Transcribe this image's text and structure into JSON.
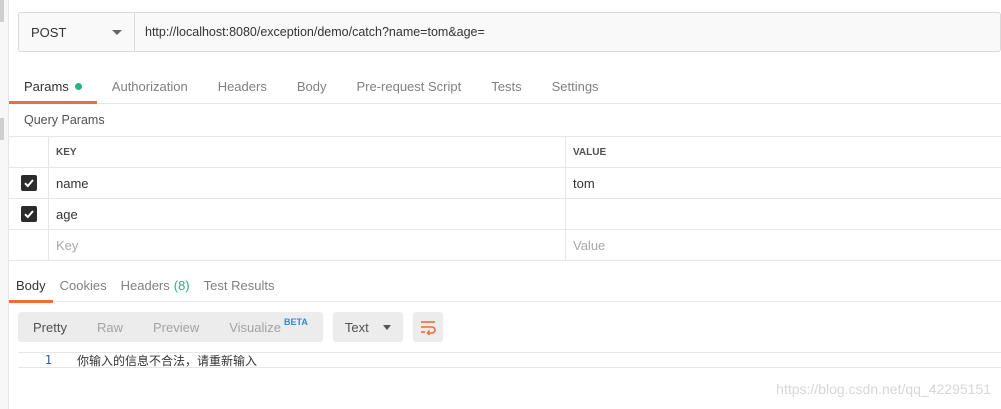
{
  "request": {
    "method": "POST",
    "url": "http://localhost:8080/exception/demo/catch?name=tom&age="
  },
  "request_tabs": [
    {
      "label": "Params",
      "active": true,
      "indicator": true
    },
    {
      "label": "Authorization"
    },
    {
      "label": "Headers"
    },
    {
      "label": "Body"
    },
    {
      "label": "Pre-request Script"
    },
    {
      "label": "Tests"
    },
    {
      "label": "Settings"
    }
  ],
  "query_params": {
    "title": "Query Params",
    "columns": {
      "key": "KEY",
      "value": "VALUE"
    },
    "rows": [
      {
        "checked": true,
        "key": "name",
        "value": "tom"
      },
      {
        "checked": true,
        "key": "age",
        "value": ""
      }
    ],
    "placeholder": {
      "key": "Key",
      "value": "Value"
    }
  },
  "response_tabs": {
    "body": "Body",
    "cookies": "Cookies",
    "headers": "Headers",
    "headers_count": "(8)",
    "test_results": "Test Results"
  },
  "response_toolbar": {
    "views": [
      "Pretty",
      "Raw",
      "Preview",
      "Visualize"
    ],
    "beta": "BETA",
    "type": "Text"
  },
  "response_body": {
    "line_number": "1",
    "text": "你输入的信息不合法，请重新输入"
  },
  "watermark": "https://blog.csdn.net/qq_42295151",
  "colors": {
    "accent": "#f26b3a",
    "success": "#26b47f",
    "beta": "#2e8ad8"
  }
}
